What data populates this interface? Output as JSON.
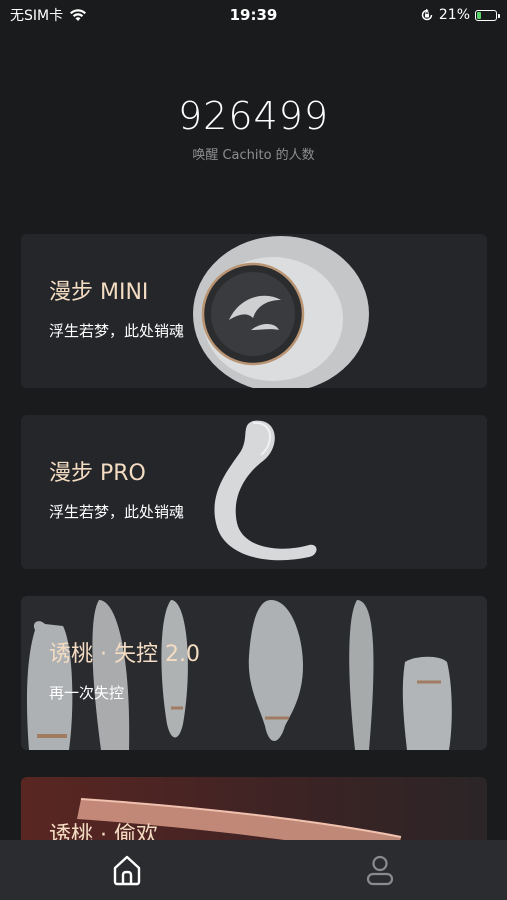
{
  "status_bar": {
    "carrier": "无SIM卡",
    "time": "19:39",
    "battery_percent": "21%",
    "battery_level": 0.21,
    "battery_color": "#5bd36b"
  },
  "hero": {
    "count": "926499",
    "caption": "唤醒 Cachito 的人数"
  },
  "products": [
    {
      "title": "漫步 MINI",
      "subtitle": "浮生若梦，此处销魂"
    },
    {
      "title": "漫步 PRO",
      "subtitle": "浮生若梦，此处销魂"
    },
    {
      "title": "诱桃 · 失控 2.0",
      "subtitle": "再一次失控"
    },
    {
      "title": "诱桃 · 偷欢",
      "subtitle": ""
    }
  ],
  "colors": {
    "background": "#1a1b1c",
    "card": "#24262a",
    "title_accent": "#f3dcc2",
    "tab_bar": "#2b2c2f"
  },
  "tab_bar": {
    "items": [
      {
        "icon": "home-icon"
      },
      {
        "icon": "profile-icon"
      }
    ]
  }
}
